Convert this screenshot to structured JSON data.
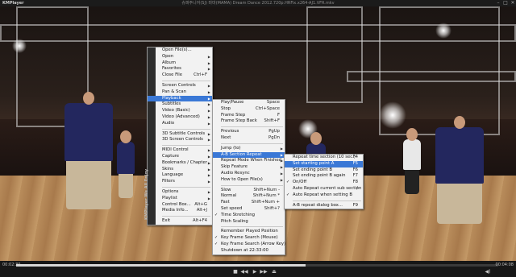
{
  "titlebar": {
    "app_name": "KMPlayer",
    "window_title": "슈퍼주니어(SJ) 마마(MAMA) Dream Dance 2012.720p.HRFix.x264-AJ1.VFR.mkv",
    "minimize": "–",
    "maximize": "□",
    "close": "✕"
  },
  "controls": {
    "time_current": "00:02:30",
    "time_total": "00:04:08",
    "progress_fraction": 0.6,
    "buttons": {
      "stop": "■",
      "prev": "◀◀",
      "play": "▶",
      "next": "▶▶",
      "eject": "⏏",
      "volume": "◀)"
    }
  },
  "main_menu": {
    "brand": "KMPlayer  We All Enjoy",
    "items": [
      {
        "label": "Open File(s)...",
        "shortcut": "",
        "arrow": false
      },
      {
        "label": "Open",
        "shortcut": "",
        "arrow": true
      },
      {
        "label": "Album",
        "shortcut": "",
        "arrow": true
      },
      {
        "label": "Favorites",
        "shortcut": "",
        "arrow": true
      },
      {
        "label": "Close File",
        "shortcut": "Ctrl+F",
        "arrow": false
      },
      {
        "sep": true
      },
      {
        "label": "Screen Controls",
        "shortcut": "",
        "arrow": true
      },
      {
        "label": "Pan & Scan",
        "shortcut": "",
        "arrow": true
      },
      {
        "label": "Playback",
        "shortcut": "",
        "arrow": true,
        "active": true
      },
      {
        "label": "Subtitles",
        "shortcut": "",
        "arrow": true
      },
      {
        "label": "Video (Basic)",
        "shortcut": "",
        "arrow": true
      },
      {
        "label": "Video (Advanced)",
        "shortcut": "",
        "arrow": true
      },
      {
        "label": "Audio",
        "shortcut": "",
        "arrow": true
      },
      {
        "sep": true
      },
      {
        "label": "3D Subtitle Controls",
        "shortcut": "",
        "arrow": true
      },
      {
        "label": "3D Screen Controls",
        "shortcut": "",
        "arrow": true
      },
      {
        "sep": true
      },
      {
        "label": "MIDI Control",
        "shortcut": "",
        "arrow": true
      },
      {
        "label": "Capture",
        "shortcut": "",
        "arrow": true
      },
      {
        "label": "Bookmarks / Chapter",
        "shortcut": "",
        "arrow": true
      },
      {
        "label": "Skins",
        "shortcut": "",
        "arrow": true
      },
      {
        "label": "Language",
        "shortcut": "",
        "arrow": true
      },
      {
        "label": "Filters",
        "shortcut": "",
        "arrow": true
      },
      {
        "sep": true
      },
      {
        "label": "Options",
        "shortcut": "",
        "arrow": true
      },
      {
        "label": "Playlist",
        "shortcut": "",
        "arrow": true
      },
      {
        "label": "Control Box...",
        "shortcut": "Alt+G",
        "arrow": false
      },
      {
        "label": "Media Info...",
        "shortcut": "Alt+J",
        "arrow": false
      },
      {
        "sep": true
      },
      {
        "label": "Exit",
        "shortcut": "Alt+F4",
        "arrow": false
      }
    ]
  },
  "playback_menu": {
    "items": [
      {
        "label": "Play/Pause",
        "shortcut": "Space"
      },
      {
        "label": "Stop",
        "shortcut": "Ctrl+Space"
      },
      {
        "label": "Frame Step",
        "shortcut": "F"
      },
      {
        "label": "Frame Step Back",
        "shortcut": "Shift+F"
      },
      {
        "sep": true
      },
      {
        "label": "Previous",
        "shortcut": "PgUp"
      },
      {
        "label": "Next",
        "shortcut": "PgDn"
      },
      {
        "sep": true
      },
      {
        "label": "Jump (to)",
        "shortcut": "",
        "arrow": true
      },
      {
        "label": "A-B Section Repeat",
        "shortcut": "",
        "arrow": true,
        "active": true
      },
      {
        "label": "Repeat Mode When Finished",
        "shortcut": "",
        "arrow": true
      },
      {
        "label": "Skip Feature",
        "shortcut": "",
        "arrow": true
      },
      {
        "label": "Audio Resync",
        "shortcut": "",
        "arrow": true
      },
      {
        "label": "How to Open File(s)",
        "shortcut": "",
        "arrow": true
      },
      {
        "sep": true
      },
      {
        "label": "Slow",
        "shortcut": "Shift+Num -"
      },
      {
        "label": "Normal",
        "shortcut": "Shift+Num *"
      },
      {
        "label": "Fast",
        "shortcut": "Shift+Num +"
      },
      {
        "label": "Set speed",
        "shortcut": "Shift+?"
      },
      {
        "label": "Time Stretching",
        "shortcut": "",
        "check": true
      },
      {
        "label": "Pitch Scaling",
        "shortcut": ""
      },
      {
        "sep": true
      },
      {
        "label": "Remember Played Position",
        "shortcut": ""
      },
      {
        "label": "Key Frame Search (Mouse)",
        "shortcut": "",
        "check": true
      },
      {
        "label": "Key Frame Search (Arrow Key)",
        "shortcut": "",
        "check": true
      },
      {
        "label": "Shutdown at 22:33:00",
        "shortcut": ""
      }
    ]
  },
  "ab_menu": {
    "items": [
      {
        "label": "Repeat time section (10 sec.)",
        "shortcut": "F4"
      },
      {
        "label": "Set starting point A",
        "shortcut": "F5",
        "active": true
      },
      {
        "label": "Set ending point B",
        "shortcut": "F6"
      },
      {
        "label": "Set ending point B again",
        "shortcut": "F7"
      },
      {
        "label": "On/Off",
        "shortcut": "F8",
        "check": true
      },
      {
        "label": "Auto Repeat current sub section",
        "shortcut": "/"
      },
      {
        "label": "Auto Repeat when setting B",
        "shortcut": "",
        "check": true
      },
      {
        "sep": true
      },
      {
        "label": "A-B repeat dialog box...",
        "shortcut": "F9"
      }
    ]
  }
}
